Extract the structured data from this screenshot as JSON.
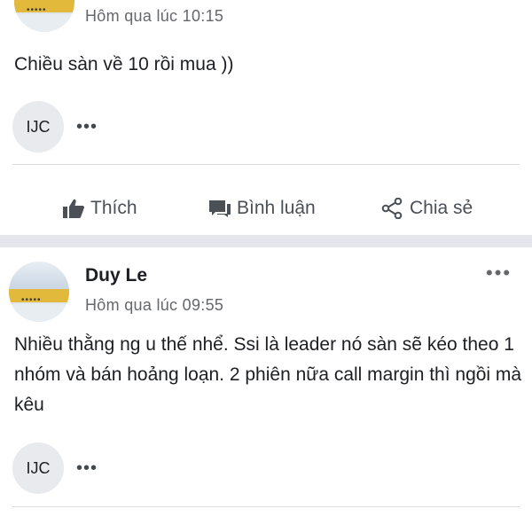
{
  "posts": [
    {
      "time": "Hôm qua lúc 10:15",
      "content": "Chiều sàn về 10 rồi mua ))",
      "group_badge": "IJC",
      "actions": {
        "like": "Thích",
        "comment": "Bình luận",
        "share": "Chia sẻ"
      }
    },
    {
      "author": "Duy Le",
      "time": "Hôm qua lúc 09:55",
      "content": "Nhiều thằng ng u thế nhể. Ssi là leader nó sàn sẽ kéo theo 1 nhóm và bán hoảng loạn. 2 phiên nữa call margin thì ngồi mà kêu",
      "group_badge": "IJC"
    }
  ],
  "colors": {
    "text": "#1c1e21",
    "secondary": "#65676b",
    "separator": "#e4e6eb"
  },
  "icons": [
    "thumbs-up-icon",
    "comment-icon",
    "share-icon",
    "more-dots-icon"
  ]
}
